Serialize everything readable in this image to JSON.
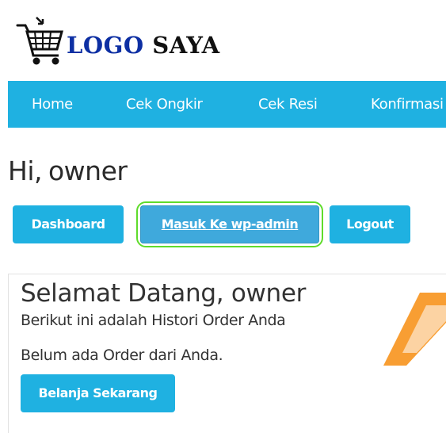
{
  "logo": {
    "word1": "LOGO",
    "word2": "SAYA",
    "icon": "shopping-cart-icon"
  },
  "navbar": {
    "items": [
      "Home",
      "Cek Ongkir",
      "Cek Resi",
      "Konfirmasi"
    ]
  },
  "greeting": {
    "prefix": "Hi,",
    "name": "owner"
  },
  "buttons": {
    "dashboard": "Dashboard",
    "wp_admin": "Masuk Ke wp-admin",
    "logout": "Logout",
    "belanja": "Belanja Sekarang"
  },
  "welcome": {
    "title": "Selamat Datang, owner",
    "history": "Berikut ini adalah Histori Order Anda",
    "no_order": "Belum ada Order dari Anda."
  },
  "colors": {
    "brand_blue": "#1fb1e1",
    "logo_blue": "#0d2fa3",
    "highlight_green": "#5fdc2b",
    "accent_orange": "#f7941d"
  }
}
